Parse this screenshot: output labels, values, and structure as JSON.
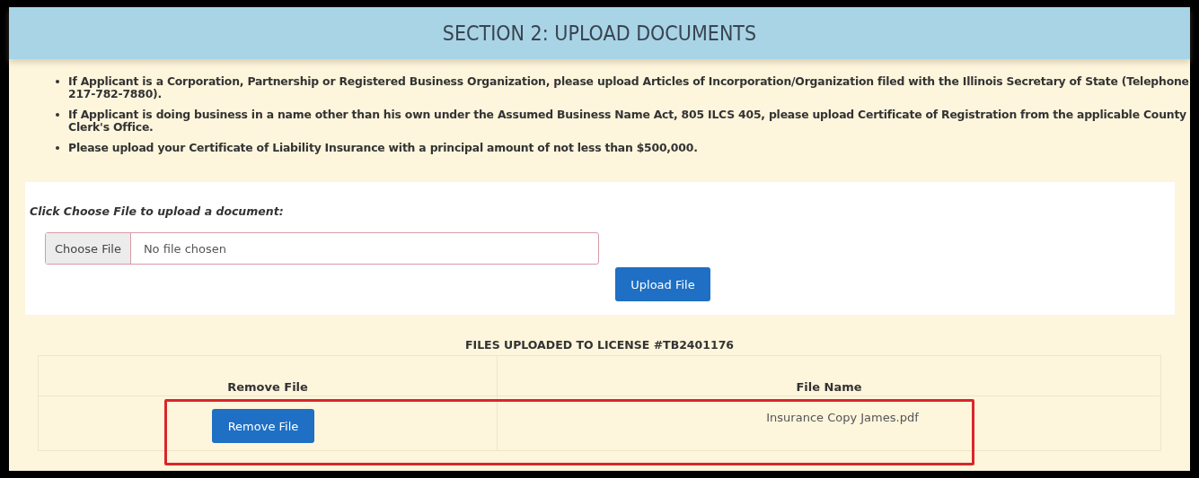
{
  "header": {
    "title": "SECTION 2: UPLOAD DOCUMENTS"
  },
  "instructions": [
    "If Applicant is a Corporation, Partnership or Registered Business Organization, please upload Articles of Incorporation/Organization filed with the Illinois Secretary of State (Telephone 217-782-7880).",
    "If Applicant is doing business in a name other than his own under the Assumed Business Name Act, 805 ILCS 405, please upload Certificate of Registration from the applicable County Clerk's Office.",
    "Please upload your Certificate of Liability Insurance with a principal amount of not less than $500,000."
  ],
  "upload": {
    "prompt": "Click Choose File to upload a document:",
    "choose_button": "Choose File",
    "file_status": "No file chosen",
    "upload_button": "Upload File"
  },
  "files_table": {
    "caption": "FILES UPLOADED TO LICENSE #TB2401176",
    "columns": [
      "Remove File",
      "File Name"
    ],
    "rows": [
      {
        "action": "Remove File",
        "file_name": "Insurance Copy James.pdf"
      }
    ]
  },
  "highlight": {
    "shown": true
  }
}
